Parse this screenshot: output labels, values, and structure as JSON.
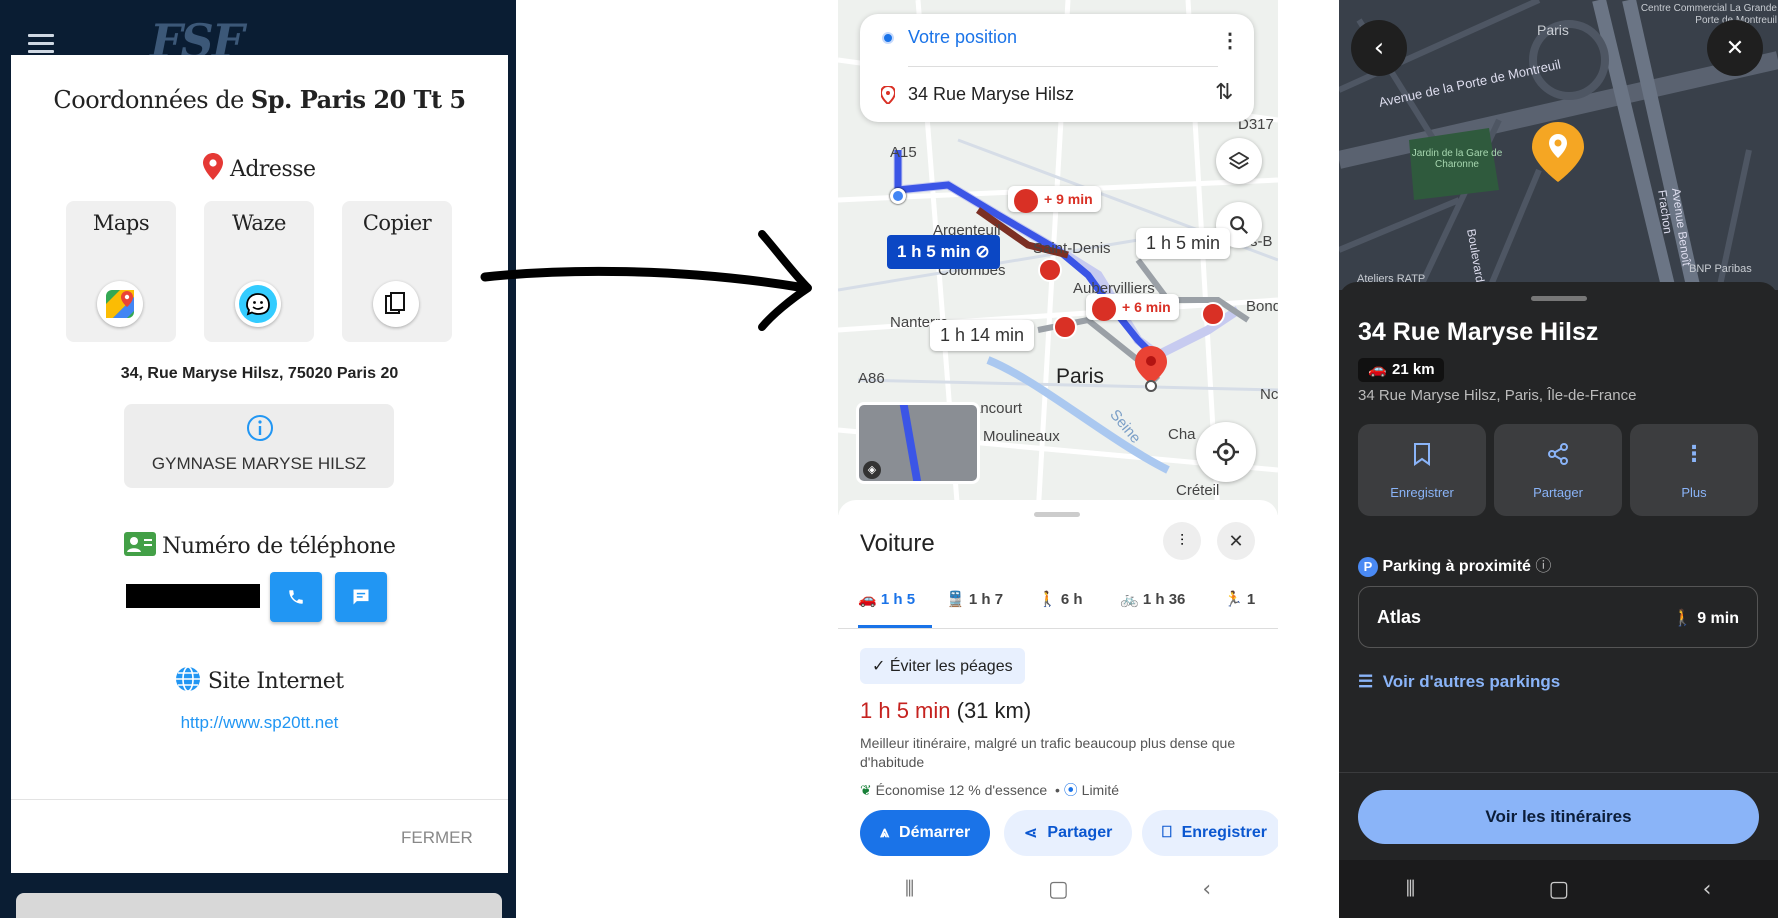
{
  "panel1": {
    "title_prefix": "Coordonnées de ",
    "title_name": "Sp. Paris 20 Tt 5",
    "address_heading": "Adresse",
    "tiles": [
      {
        "label": "Maps"
      },
      {
        "label": "Waze"
      },
      {
        "label": "Copier"
      }
    ],
    "address": "34, Rue Maryse Hilsz, 75020 Paris 20",
    "venue": "GYMNASE MARYSE HILSZ",
    "phone_heading": "Numéro de téléphone",
    "website_heading": "Site Internet",
    "website_url": "http://www.sp20tt.net",
    "close_label": "FERMER"
  },
  "panel2": {
    "origin": "Votre position",
    "destination": "34 Rue Maryse Hilsz",
    "map_labels": [
      "A15",
      "D317",
      "A86",
      "Argenteuil",
      "Saint-Denis",
      "Colombes",
      "Aubervilliers",
      "Nanterre",
      "Paris",
      "Bondy",
      "ancourt",
      "Moulineaux",
      "Seine",
      "Cha",
      "Créteil",
      "s-B",
      "Nc"
    ],
    "traffic": [
      "+ 9 min",
      "+ 6 min"
    ],
    "route_selected": "1 h 5 min",
    "route_alt1": "1 h 5 min",
    "route_alt2": "1 h 14 min",
    "sheet_title": "Voiture",
    "modes": [
      {
        "label": "1 h 5"
      },
      {
        "label": "1 h 7"
      },
      {
        "label": "6 h"
      },
      {
        "label": "1 h 36"
      },
      {
        "label": "1"
      }
    ],
    "avoid_tolls": "Éviter les péages",
    "duration": "1 h 5 min",
    "distance": "(31 km)",
    "description": "Meilleur itinéraire, malgré un trafic beaucoup plus dense que d'habitude",
    "fuel": "Économise 12 % d'essence",
    "limited": "Limité",
    "start": "Démarrer",
    "share": "Partager",
    "save": "Enregistrer"
  },
  "panel3": {
    "map_labels": [
      "Paris",
      "Centre Commercial La Grande Porte de Montreuil",
      "Avenue de la Porte de Montreuil",
      "Jardin de la Gare de Charonne",
      "Avenue Benoît Frachon",
      "Boulevard",
      "Ateliers RATP",
      "BNP Paribas"
    ],
    "title": "34 Rue Maryse Hilsz",
    "distance": "21 km",
    "subtitle": "34 Rue Maryse Hilsz, Paris, Île-de-France",
    "actions": [
      {
        "label": "Enregistrer"
      },
      {
        "label": "Partager"
      },
      {
        "label": "Plus"
      }
    ],
    "parking_heading": "Parking à proximité",
    "parking_name": "Atlas",
    "parking_walk": "9 min",
    "more_parkings": "Voir d'autres parkings",
    "cta": "Voir les itinéraires"
  }
}
